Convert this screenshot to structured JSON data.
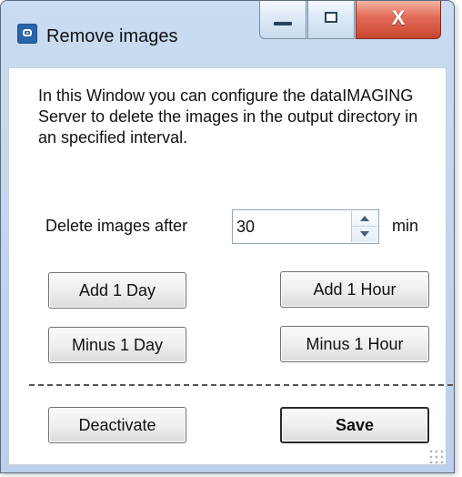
{
  "window": {
    "title": "Remove images"
  },
  "title_controls": {
    "minimize_icon": "minimize-icon",
    "maximize_icon": "maximize-icon",
    "close_label": "X"
  },
  "main": {
    "description": "In this Window you can configure the dataIMAGING Server to delete the images in the output directory in an specified interval.",
    "delete_label": "Delete images after",
    "minutes_value": "30",
    "unit_label": "min"
  },
  "buttons": {
    "add_day": "Add 1 Day",
    "add_hour": "Add 1 Hour",
    "minus_day": "Minus 1 Day",
    "minus_hour": "Minus 1 Hour",
    "deactivate": "Deactivate",
    "save": "Save"
  },
  "colors": {
    "title_bar": "#c9dcf1",
    "close_button": "#d95a45",
    "button_border": "#707070"
  },
  "icons": {
    "app": "app-icon",
    "spin_up": "spin-up-icon",
    "spin_down": "spin-down-icon",
    "resize": "resize-grip-icon"
  }
}
